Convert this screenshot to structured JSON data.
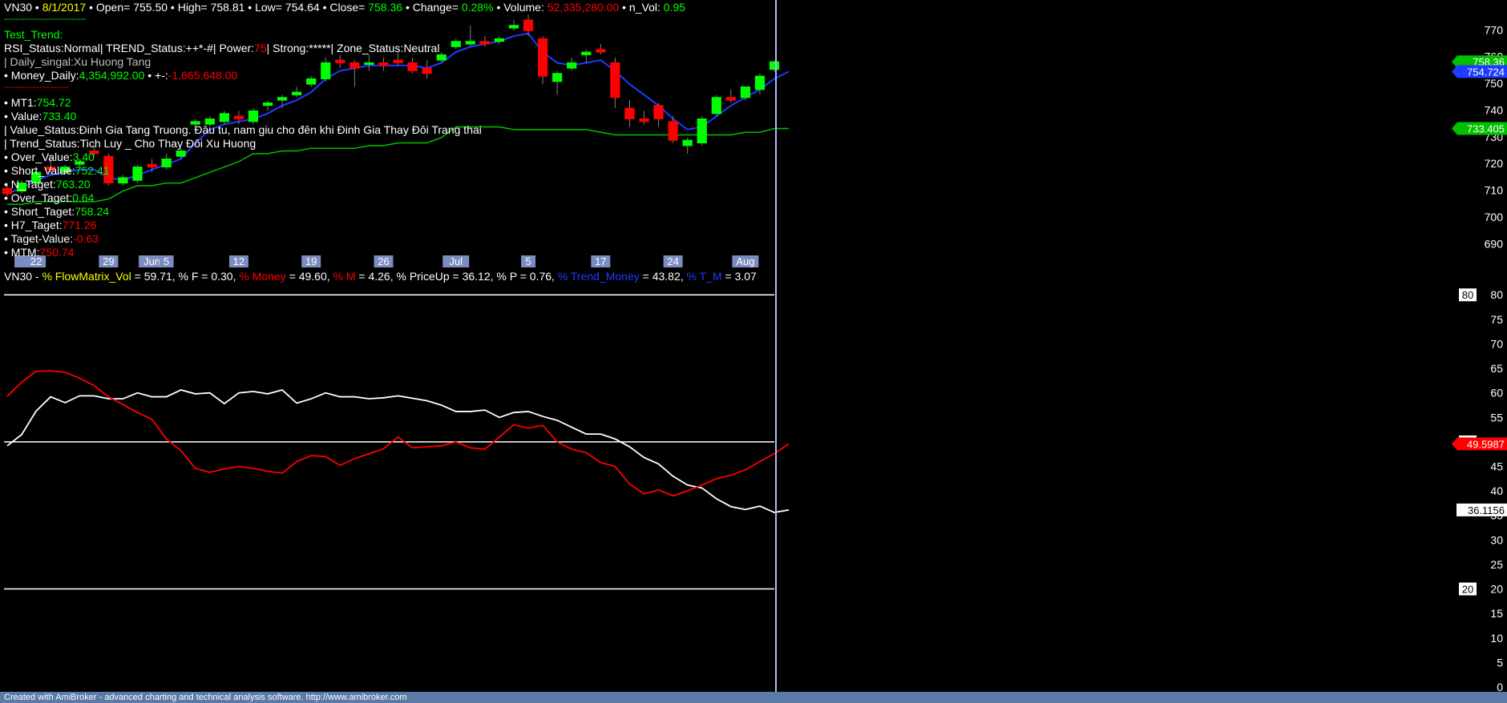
{
  "header": {
    "symbol": "VN30 •",
    "date": "8/1/2017",
    "open_label": "• Open=",
    "open": "755.50",
    "high_label": "• High=",
    "high": "758.81",
    "low_label": "• Low=",
    "low": "754.64",
    "close_label": "• Close=",
    "close": "758.36",
    "change_label": "• Change=",
    "change": "0.28%",
    "volume_label": "• Volume:",
    "volume": "52,335,280.00",
    "nvol_label": "• n_Vol:",
    "nvol": "0.95"
  },
  "overlay": {
    "dashes": "----------------------------",
    "test_trend": "Test_Trend:",
    "status_a": "RSI_Status:Normal| TREND_Status:++*-#| Power:",
    "power": "75",
    "status_b": "| Strong:*****| Zone_Status:Neutral",
    "daily_signal": "| Daily_singal:Xu Huong Tang",
    "money_label": "• Money_Daily:",
    "money_value": "4,354,992.00",
    "money_sep": "• +-:",
    "money_change": "-1,665,648.00",
    "red_dashes": "----------------------",
    "mt1_label": "• MT1:",
    "mt1": "754.72",
    "value_label": "• Value:",
    "value": "733.40",
    "value_status": "| Value_Status:Đinh Gia Tang Truong. Đâu tu, nam giu cho đên khi Đinh Gia Thay Đôi Trang thai",
    "trend_status": "| Trend_Status:Tich Luy _ Cho Thay Đôi Xu Huong",
    "over_value_label": "• Over_Value:",
    "over_value": "3.40",
    "short_value_label": "• Short_Value:",
    "short_value": "752.41",
    "n_taget_label": "• N_Taget:",
    "n_taget": "763.20",
    "over_taget_label": "• Over_Taget:",
    "over_taget": "0.64",
    "short_taget_label": "• Short_Taget:",
    "short_taget": "758.24",
    "h7_label": "• H7_Taget:",
    "h7": "771.26",
    "taget_value_label": "• Taget-Value:",
    "taget_value": "-0.63",
    "mtm_label": "• MTM:",
    "mtm": "750.74"
  },
  "indicator_title": {
    "prefix": "VN30 - ",
    "parts": [
      {
        "text": "% FlowMatrix_Vol",
        "color": "#ffff00"
      },
      {
        "text": " = 59.71, % F = 0.30, ",
        "color": "#ffffff"
      },
      {
        "text": "% Money",
        "color": "#ff0000"
      },
      {
        "text": " = 49.60, ",
        "color": "#ffffff"
      },
      {
        "text": "% M",
        "color": "#ff0000"
      },
      {
        "text": " = 4.26, % PriceUp = 36.12, % P = 0.76, ",
        "color": "#ffffff"
      },
      {
        "text": "% Trend_Money",
        "color": "#1e3cff"
      },
      {
        "text": " = 43.82, ",
        "color": "#ffffff"
      },
      {
        "text": "% T_M",
        "color": "#1e3cff"
      },
      {
        "text": " = 3.07",
        "color": "#ffffff"
      }
    ]
  },
  "footer": "Created with AmiBroker - advanced charting and technical analysis software. http://www.amibroker.com",
  "chart_data": [
    {
      "type": "candlestick",
      "title": "VN30",
      "ylim": [
        685,
        780
      ],
      "yticks": [
        690,
        700,
        710,
        720,
        730,
        740,
        750,
        760,
        770
      ],
      "date_labels": [
        {
          "label": "22",
          "index": 2
        },
        {
          "label": "29",
          "index": 7
        },
        {
          "label": "Jun",
          "index": 10
        },
        {
          "label": "5",
          "index": 11
        },
        {
          "label": "12",
          "index": 16
        },
        {
          "label": "19",
          "index": 21
        },
        {
          "label": "26",
          "index": 26
        },
        {
          "label": "Jul",
          "index": 31
        },
        {
          "label": "5",
          "index": 36
        },
        {
          "label": "17",
          "index": 41
        },
        {
          "label": "24",
          "index": 46
        },
        {
          "label": "Aug",
          "index": 51
        }
      ],
      "candles": [
        {
          "o": 711,
          "h": 713,
          "l": 708,
          "c": 709
        },
        {
          "o": 710,
          "h": 714,
          "l": 709,
          "c": 713
        },
        {
          "o": 713,
          "h": 718,
          "l": 712,
          "c": 717
        },
        {
          "o": 719,
          "h": 723,
          "l": 716,
          "c": 718
        },
        {
          "o": 717,
          "h": 720,
          "l": 716,
          "c": 719
        },
        {
          "o": 720,
          "h": 722,
          "l": 719,
          "c": 721
        },
        {
          "o": 725,
          "h": 727,
          "l": 723,
          "c": 724
        },
        {
          "o": 723,
          "h": 724,
          "l": 712,
          "c": 713
        },
        {
          "o": 713,
          "h": 716,
          "l": 712,
          "c": 715
        },
        {
          "o": 714,
          "h": 720,
          "l": 713,
          "c": 719
        },
        {
          "o": 720,
          "h": 722,
          "l": 717,
          "c": 719
        },
        {
          "o": 719,
          "h": 724,
          "l": 718,
          "c": 722
        },
        {
          "o": 723,
          "h": 726,
          "l": 722,
          "c": 725
        },
        {
          "o": 735,
          "h": 737,
          "l": 734,
          "c": 736
        },
        {
          "o": 735,
          "h": 738,
          "l": 734,
          "c": 737
        },
        {
          "o": 736,
          "h": 740,
          "l": 735,
          "c": 739
        },
        {
          "o": 738,
          "h": 740,
          "l": 735,
          "c": 737
        },
        {
          "o": 736,
          "h": 741,
          "l": 735,
          "c": 740
        },
        {
          "o": 742,
          "h": 744,
          "l": 740,
          "c": 743
        },
        {
          "o": 744,
          "h": 746,
          "l": 741,
          "c": 745
        },
        {
          "o": 746,
          "h": 749,
          "l": 745,
          "c": 747
        },
        {
          "o": 750,
          "h": 753,
          "l": 749,
          "c": 752
        },
        {
          "o": 752,
          "h": 760,
          "l": 751,
          "c": 758
        },
        {
          "o": 759,
          "h": 761,
          "l": 756,
          "c": 758
        },
        {
          "o": 758,
          "h": 759,
          "l": 749,
          "c": 756
        },
        {
          "o": 758,
          "h": 761,
          "l": 755,
          "c": 758
        },
        {
          "o": 758,
          "h": 760,
          "l": 755,
          "c": 757
        },
        {
          "o": 759,
          "h": 762,
          "l": 757,
          "c": 758
        },
        {
          "o": 758,
          "h": 760,
          "l": 754,
          "c": 755
        },
        {
          "o": 756,
          "h": 759,
          "l": 752,
          "c": 754
        },
        {
          "o": 759,
          "h": 762,
          "l": 758,
          "c": 761
        },
        {
          "o": 764,
          "h": 767,
          "l": 763,
          "c": 766
        },
        {
          "o": 765,
          "h": 772,
          "l": 764,
          "c": 766
        },
        {
          "o": 766,
          "h": 768,
          "l": 764,
          "c": 765
        },
        {
          "o": 766,
          "h": 768,
          "l": 765,
          "c": 767
        },
        {
          "o": 771,
          "h": 774,
          "l": 770,
          "c": 772
        },
        {
          "o": 774,
          "h": 776,
          "l": 768,
          "c": 770
        },
        {
          "o": 767,
          "h": 768,
          "l": 750,
          "c": 753
        },
        {
          "o": 751,
          "h": 755,
          "l": 746,
          "c": 754
        },
        {
          "o": 756,
          "h": 760,
          "l": 755,
          "c": 758
        },
        {
          "o": 761,
          "h": 763,
          "l": 758,
          "c": 762
        },
        {
          "o": 763,
          "h": 765,
          "l": 761,
          "c": 762
        },
        {
          "o": 758,
          "h": 760,
          "l": 741,
          "c": 745
        },
        {
          "o": 741,
          "h": 744,
          "l": 734,
          "c": 737
        },
        {
          "o": 737,
          "h": 740,
          "l": 735,
          "c": 736
        },
        {
          "o": 742,
          "h": 743,
          "l": 734,
          "c": 737
        },
        {
          "o": 736,
          "h": 738,
          "l": 728,
          "c": 729
        },
        {
          "o": 727,
          "h": 730,
          "l": 724,
          "c": 729
        },
        {
          "o": 728,
          "h": 738,
          "l": 727,
          "c": 737
        },
        {
          "o": 739,
          "h": 746,
          "l": 738,
          "c": 745
        },
        {
          "o": 745,
          "h": 748,
          "l": 743,
          "c": 744
        },
        {
          "o": 745,
          "h": 749,
          "l": 744,
          "c": 749
        },
        {
          "o": 748,
          "h": 754,
          "l": 746,
          "c": 753
        },
        {
          "o": 755.5,
          "h": 758.81,
          "l": 754.64,
          "c": 758.36
        }
      ],
      "ma_blue": [
        709,
        711,
        714,
        716,
        717,
        718,
        718,
        715,
        714,
        716,
        718,
        720,
        722,
        728,
        733,
        735,
        736,
        737,
        739,
        742,
        744,
        747,
        752,
        755,
        756,
        757,
        757,
        757,
        757,
        756,
        758,
        762,
        764,
        765,
        766,
        768,
        769,
        762,
        758,
        757,
        758,
        759,
        755,
        750,
        746,
        742,
        737,
        733,
        734,
        738,
        742,
        745,
        748,
        752,
        754.72
      ],
      "value_line": [
        705,
        705,
        706,
        706,
        706,
        706,
        706,
        707,
        710,
        712,
        712,
        713,
        713,
        715,
        717,
        719,
        721,
        724,
        724,
        725,
        725,
        726,
        726,
        726,
        726,
        727,
        727,
        728,
        728,
        728,
        730,
        734,
        734,
        734,
        734,
        733,
        733,
        733,
        733,
        733,
        733,
        732,
        731,
        731,
        731,
        731,
        731,
        731,
        731,
        731,
        731,
        732,
        732,
        733.4,
        733.4
      ],
      "right_labels": [
        {
          "text": "758.36",
          "value": 758.36,
          "color": "#00c000"
        },
        {
          "text": "754.724",
          "value": 754.72,
          "color": "#1e3cff"
        },
        {
          "text": "733.405",
          "value": 733.4,
          "color": "#00c000"
        }
      ]
    },
    {
      "type": "line",
      "title": "VN30 FlowMatrix",
      "ylim": [
        0,
        82
      ],
      "yticks": [
        0,
        5,
        10,
        15,
        20,
        25,
        30,
        35,
        40,
        45,
        50,
        55,
        60,
        65,
        70,
        75,
        80
      ],
      "hlines": [
        80,
        50,
        20
      ],
      "box_labels": [
        {
          "text": "80",
          "value": 80
        },
        {
          "text": "50",
          "value": 50
        },
        {
          "text": "20",
          "value": 20
        }
      ],
      "series": [
        {
          "name": "% PriceUp",
          "color": "#ffffff",
          "values": [
            49.2,
            51.5,
            56.3,
            59.2,
            58.0,
            59.4,
            59.4,
            58.8,
            58.8,
            60.0,
            59.2,
            59.2,
            60.6,
            59.8,
            60.0,
            57.8,
            60.0,
            60.3,
            59.8,
            60.6,
            57.9,
            58.8,
            60.0,
            59.2,
            59.2,
            58.8,
            59.0,
            59.4,
            58.9,
            58.4,
            57.5,
            56.2,
            56.2,
            56.5,
            55.0,
            56.0,
            56.2,
            55.2,
            54.4,
            53.0,
            51.6,
            51.6,
            50.6,
            49.0,
            46.8,
            45.5,
            43.0,
            41.2,
            40.6,
            38.4,
            36.8,
            36.2,
            36.9,
            35.6,
            36.12
          ]
        },
        {
          "name": "% Money",
          "color": "#ff0000",
          "values": [
            59.3,
            62.2,
            64.4,
            64.5,
            64.2,
            63.0,
            61.5,
            59.2,
            57.6,
            56.0,
            54.6,
            50.6,
            48.2,
            44.6,
            43.8,
            44.5,
            45.0,
            44.6,
            44.0,
            43.6,
            46.0,
            47.2,
            47.0,
            45.2,
            46.6,
            47.6,
            48.6,
            51.0,
            48.8,
            49.0,
            49.2,
            50.0,
            48.8,
            48.5,
            51.0,
            53.5,
            52.8,
            53.4,
            50.0,
            48.5,
            47.8,
            45.8,
            45.0,
            41.4,
            39.4,
            40.2,
            39.0,
            40.0,
            41.2,
            42.5,
            43.2,
            44.3,
            46.0,
            47.6,
            49.6
          ]
        }
      ],
      "right_labels": [
        {
          "text": "49.5987",
          "value": 49.6,
          "color": "#ff0000"
        },
        {
          "text": "36.1156",
          "value": 36.12,
          "color": "#ffffff"
        }
      ]
    }
  ]
}
